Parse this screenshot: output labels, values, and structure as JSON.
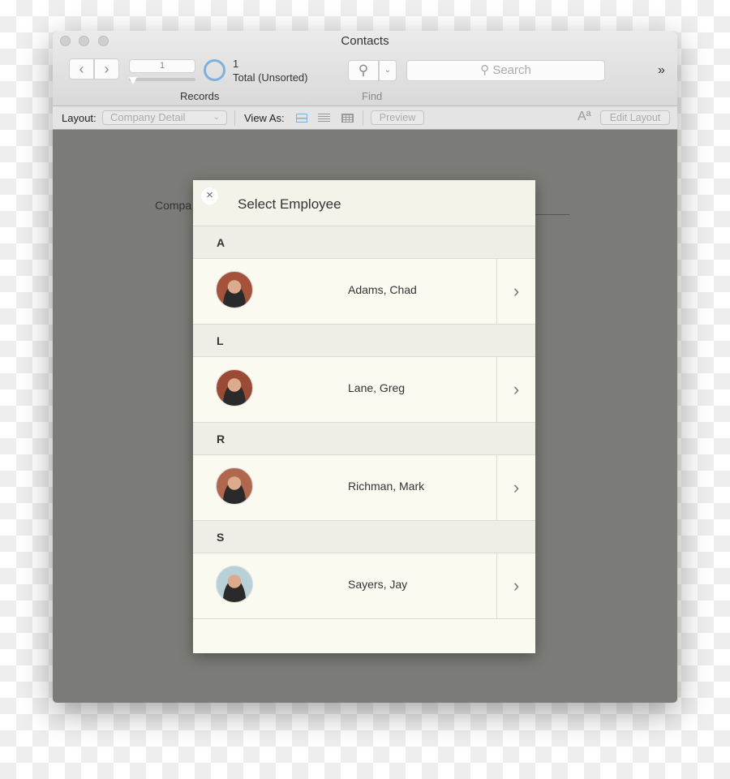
{
  "window": {
    "title": "Contacts"
  },
  "toolbar": {
    "record_number": "1",
    "record_count": "1",
    "record_status": "Total (Unsorted)",
    "records_label": "Records",
    "find_label": "Find",
    "search_placeholder": "Search",
    "overflow": "»"
  },
  "layoutbar": {
    "layout_label": "Layout:",
    "layout_value": "Company Detail",
    "view_as_label": "View As:",
    "preview_label": "Preview",
    "edit_layout_label": "Edit Layout",
    "font_icon_text": "Aª"
  },
  "background": {
    "field_label": "Compa"
  },
  "dialog": {
    "title": "Select Employee",
    "close": "×",
    "sections": [
      {
        "letter": "A",
        "name": "Adams, Chad"
      },
      {
        "letter": "L",
        "name": "Lane, Greg"
      },
      {
        "letter": "R",
        "name": "Richman, Mark"
      },
      {
        "letter": "S",
        "name": "Sayers, Jay"
      }
    ]
  },
  "colors": {
    "accent": "#7fb0dc",
    "content_bg": "#7b7b77",
    "dialog_bg": "#fbfaf0"
  }
}
